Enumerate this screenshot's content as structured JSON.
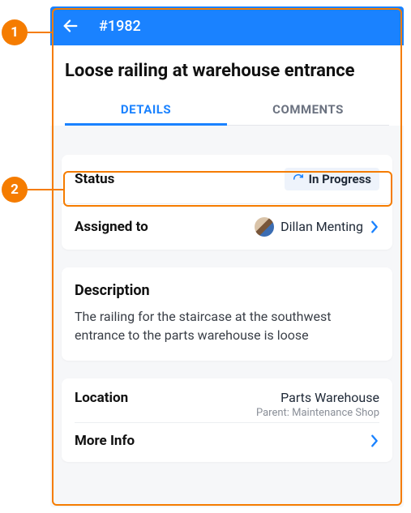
{
  "callouts": {
    "one": "1",
    "two": "2"
  },
  "header": {
    "work_id": "#1982"
  },
  "title": "Loose railing at warehouse entrance",
  "tabs": {
    "details": "DETAILS",
    "comments": "COMMENTS"
  },
  "status": {
    "label": "Status",
    "value": "In Progress"
  },
  "assigned": {
    "label": "Assigned to",
    "name": "Dillan Menting"
  },
  "description": {
    "label": "Description",
    "body": "The railing for the staircase at the southwest entrance to the parts warehouse is loose"
  },
  "location": {
    "label": "Location",
    "name": "Parts Warehouse",
    "parent": "Parent: Maintenance Shop"
  },
  "more_info": {
    "label": "More Info"
  }
}
